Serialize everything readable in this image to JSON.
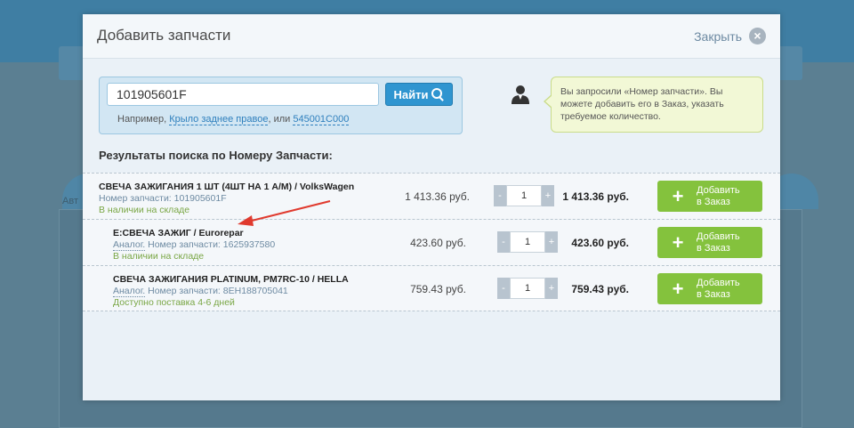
{
  "background": {
    "fragment_left": "Авт"
  },
  "modal": {
    "title": "Добавить запчасти",
    "close_label": "Закрыть"
  },
  "search": {
    "value": "101905601F",
    "button_label": "Найти",
    "hint_prefix": "Например,",
    "hint_link1": "Крыло заднее правое",
    "hint_or": ", или",
    "hint_link2": "545001C000"
  },
  "tip": {
    "text": "Вы запросили «Номер запчасти». Вы можете добавить его в Заказ, указать требуемое количество."
  },
  "results": {
    "title": "Результаты поиска по Номеру Запчасти:",
    "add_label_line1": "Добавить",
    "add_label_line2": "в Заказ",
    "rows": [
      {
        "name": "СВЕЧА ЗАЖИГАНИЯ 1 ШТ (4ШТ НА 1 А/М) / VolksWagen",
        "analog": "",
        "partno": "Номер запчасти: 101905601F",
        "availability": "В наличии на складе",
        "price": "1 413.36 руб.",
        "qty": "1",
        "total": "1 413.36 руб."
      },
      {
        "name": "E:СВЕЧА ЗАЖИГ / Eurorepar",
        "analog": "Аналог.",
        "partno": " Номер запчасти: 1625937580",
        "availability": "В наличии на складе",
        "price": "423.60 руб.",
        "qty": "1",
        "total": "423.60 руб."
      },
      {
        "name": "СВЕЧА ЗАЖИГАНИЯ PLATINUM, PM7RC-10 / HELLA",
        "analog": "Аналог.",
        "partno": " Номер запчасти: 8EH188705041",
        "availability": "Доступно поставка 4-6 дней",
        "price": "759.43 руб.",
        "qty": "1",
        "total": "759.43 руб."
      }
    ]
  },
  "colors": {
    "accent_blue": "#2f95d0",
    "add_green": "#84c23d",
    "availability_green": "#79a644",
    "annotation_red": "#e03a2e"
  }
}
